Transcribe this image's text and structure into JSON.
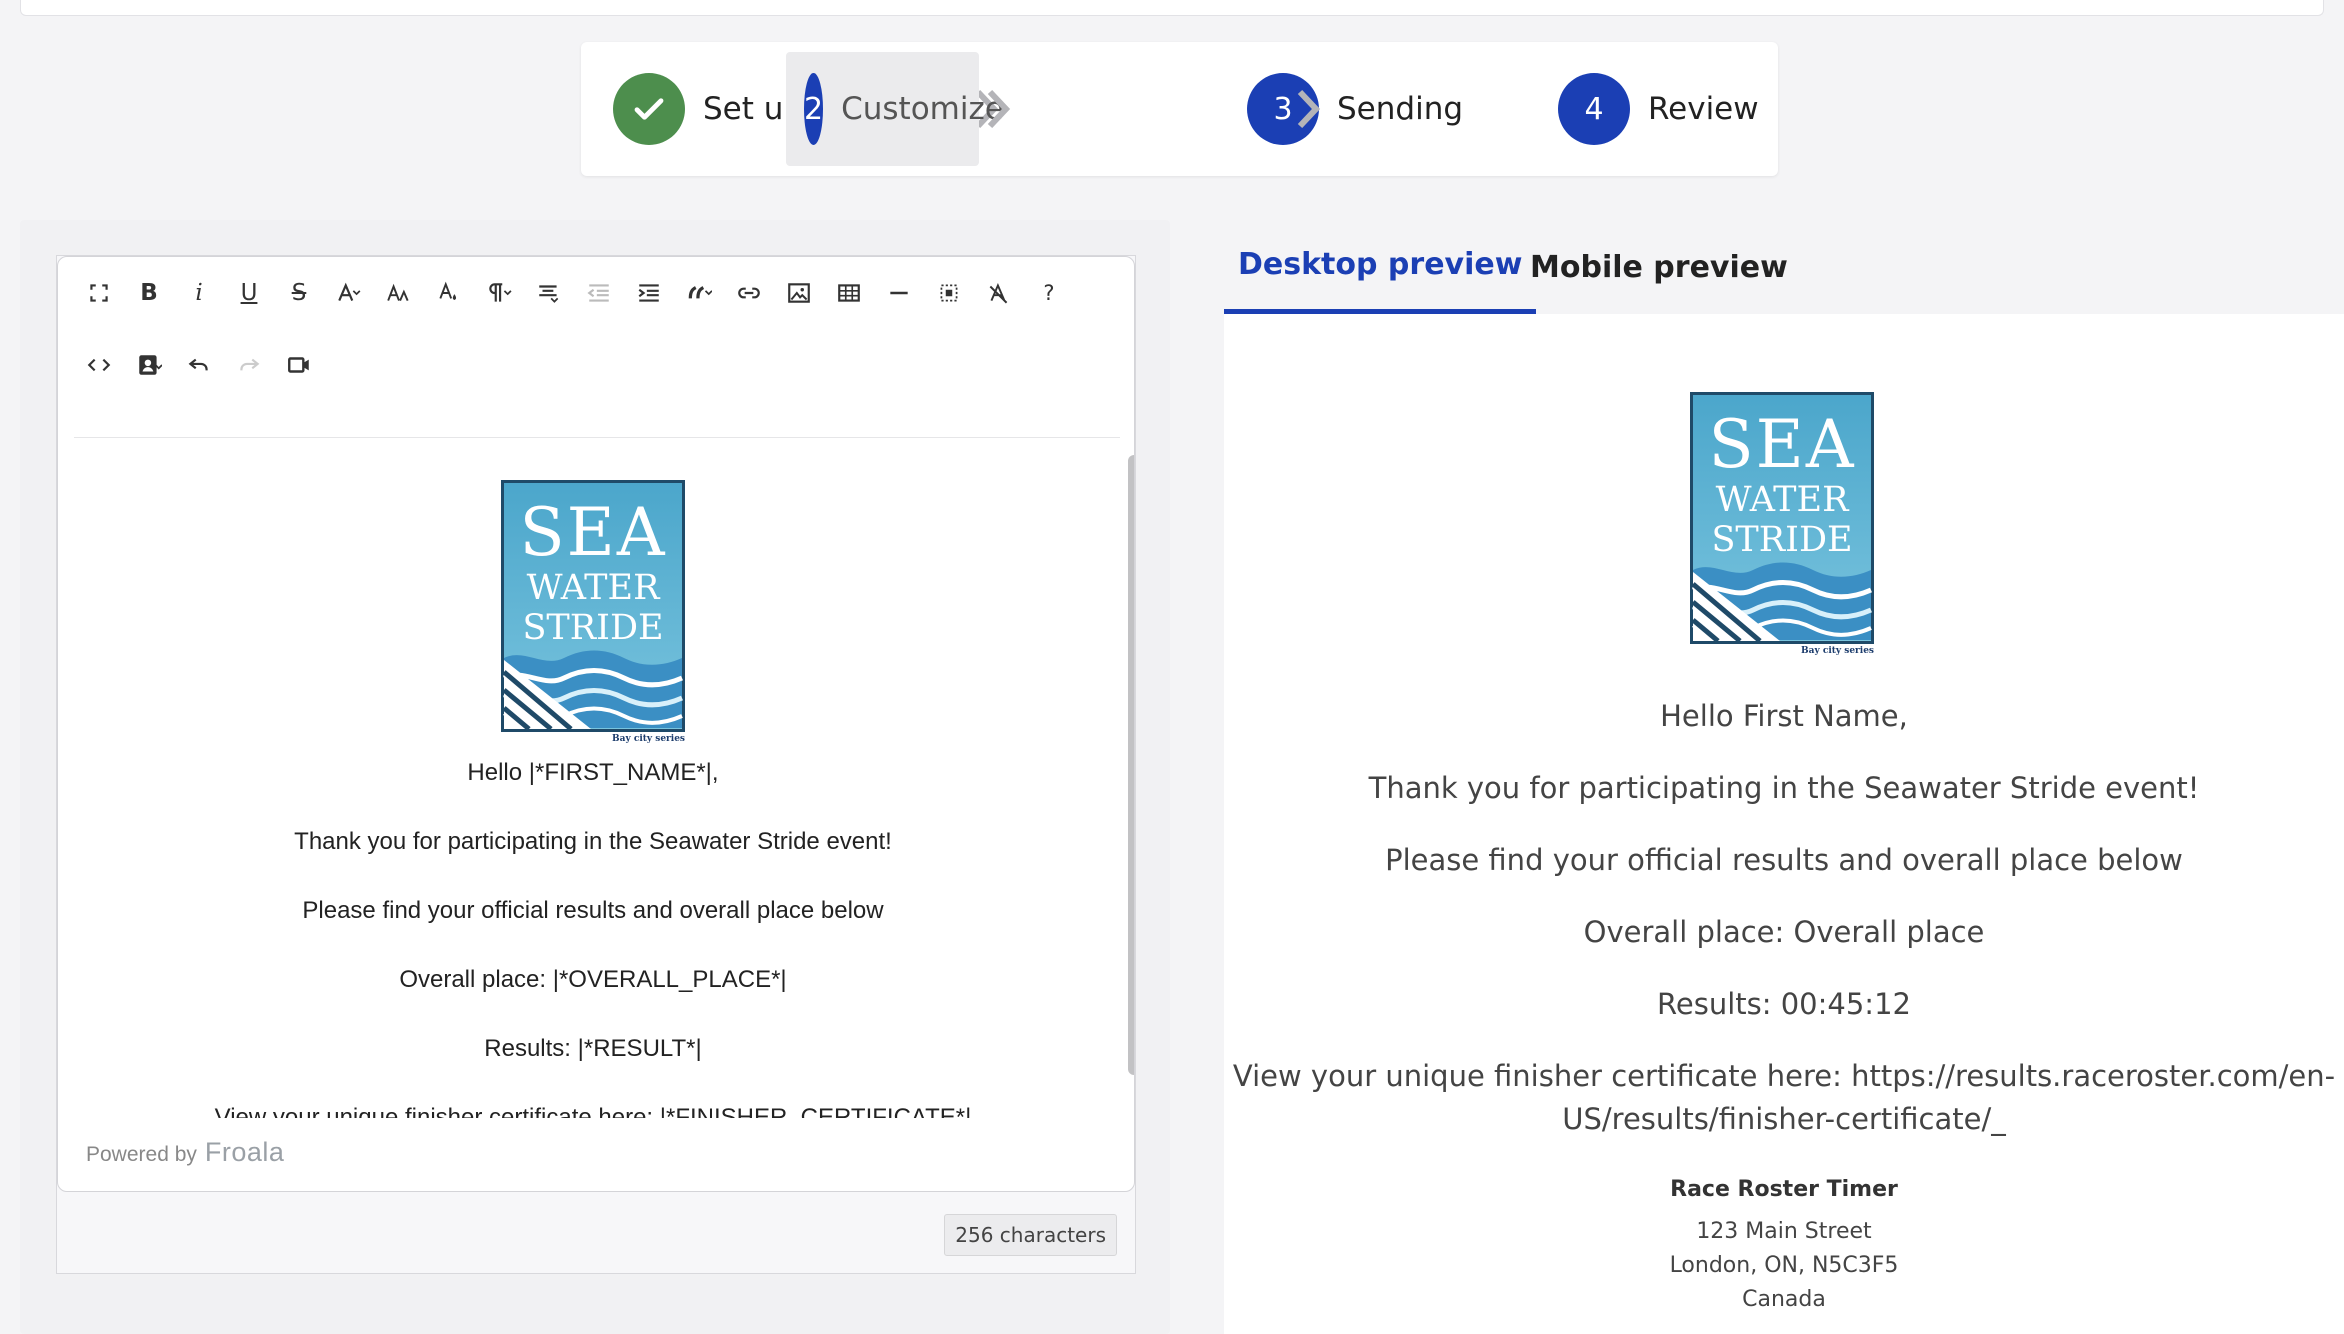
{
  "stepper": {
    "steps": [
      {
        "number": "",
        "label": "Set up",
        "state": "done"
      },
      {
        "number": "2",
        "label": "Customize",
        "state": "active"
      },
      {
        "number": "3",
        "label": "Sending",
        "state": "pending"
      },
      {
        "number": "4",
        "label": "Review",
        "state": "pending"
      }
    ]
  },
  "editor": {
    "toolbar_icons_row1": [
      "fullscreen-icon",
      "bold-icon",
      "italic-icon",
      "underline-icon",
      "strikethrough-icon",
      "font-family-icon",
      "font-size-icon",
      "text-color-icon",
      "paragraph-format-icon",
      "align-icon",
      "outdent-icon",
      "indent-icon",
      "quote-icon",
      "link-icon",
      "image-icon",
      "table-icon",
      "horizontal-line-icon",
      "select-all-icon",
      "clear-formatting-icon",
      "help-icon"
    ],
    "toolbar_icons_row2": [
      "code-view-icon",
      "merge-tag-icon",
      "undo-icon",
      "redo-icon",
      "video-icon"
    ],
    "bold_glyph": "B",
    "italic_glyph": "i",
    "underline_glyph": "U",
    "strike_glyph": "S",
    "help_glyph": "?",
    "logo": {
      "line1": "SEA",
      "line2": "WATER",
      "line3": "STRIDE",
      "sub": "Bay city series"
    },
    "lines": {
      "greeting": "Hello |*FIRST_NAME*|,",
      "thanks": "Thank you for participating in the Seawater Stride event!",
      "find": "Please find your official results and overall place below",
      "place": "Overall place: |*OVERALL_PLACE*|",
      "results": "Results: |*RESULT*|",
      "certificate": "View your unique finisher certificate here: |*FINISHER_CERTIFICATE*|"
    },
    "powered_by": "Powered by",
    "powered_brand": "Froala",
    "char_count": "256 characters"
  },
  "preview": {
    "tabs": [
      {
        "label": "Desktop preview",
        "active": true
      },
      {
        "label": "Mobile preview",
        "active": false
      }
    ],
    "lines": {
      "greeting": "Hello First Name,",
      "thanks": "Thank you for participating in the Seawater Stride event!",
      "find": "Please find your official results and overall place below",
      "place": "Overall place: Overall place",
      "results": "Results: 00:45:12",
      "certificate_1": "View your unique finisher certificate here: https://results.raceroster.com/en-",
      "certificate_2": "US/results/finisher-certificate/_"
    },
    "signature": {
      "name": "Race Roster Timer",
      "street": "123 Main Street",
      "city": "London, ON, N5C3F5",
      "country": "Canada"
    }
  },
  "colors": {
    "accent": "#1b3fb4",
    "success": "#4d8e4d"
  }
}
